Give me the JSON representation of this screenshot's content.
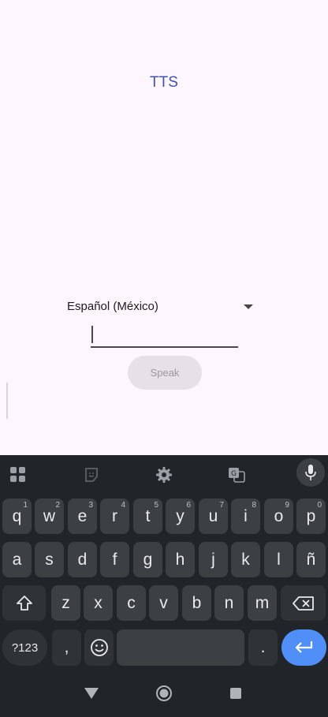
{
  "app": {
    "title": "TTS",
    "language_spinner": {
      "selected": "Español (México)"
    },
    "text_input": {
      "value": "",
      "placeholder": ""
    },
    "speak_button": "Speak"
  },
  "keyboard": {
    "toolbar": [
      "apps-grid-icon",
      "sticker-icon",
      "settings-gear-icon",
      "translate-icon",
      "mic-icon"
    ],
    "row1": [
      {
        "key": "q",
        "hint": "1"
      },
      {
        "key": "w",
        "hint": "2"
      },
      {
        "key": "e",
        "hint": "3"
      },
      {
        "key": "r",
        "hint": "4"
      },
      {
        "key": "t",
        "hint": "5"
      },
      {
        "key": "y",
        "hint": "6"
      },
      {
        "key": "u",
        "hint": "7"
      },
      {
        "key": "i",
        "hint": "8"
      },
      {
        "key": "o",
        "hint": "9"
      },
      {
        "key": "p",
        "hint": "0"
      }
    ],
    "row2": [
      "a",
      "s",
      "d",
      "f",
      "g",
      "h",
      "j",
      "k",
      "l",
      "ñ"
    ],
    "row3": [
      "z",
      "x",
      "c",
      "v",
      "b",
      "n",
      "m"
    ],
    "symbols_key": "?123",
    "comma_key": ",",
    "period_key": "."
  },
  "colors": {
    "app_bg": "#fdf7fd",
    "title": "#3f51b5",
    "keyboard_bg": "#212529",
    "key_bg": "#3c4043",
    "enter_bg": "#4f8ff7"
  }
}
